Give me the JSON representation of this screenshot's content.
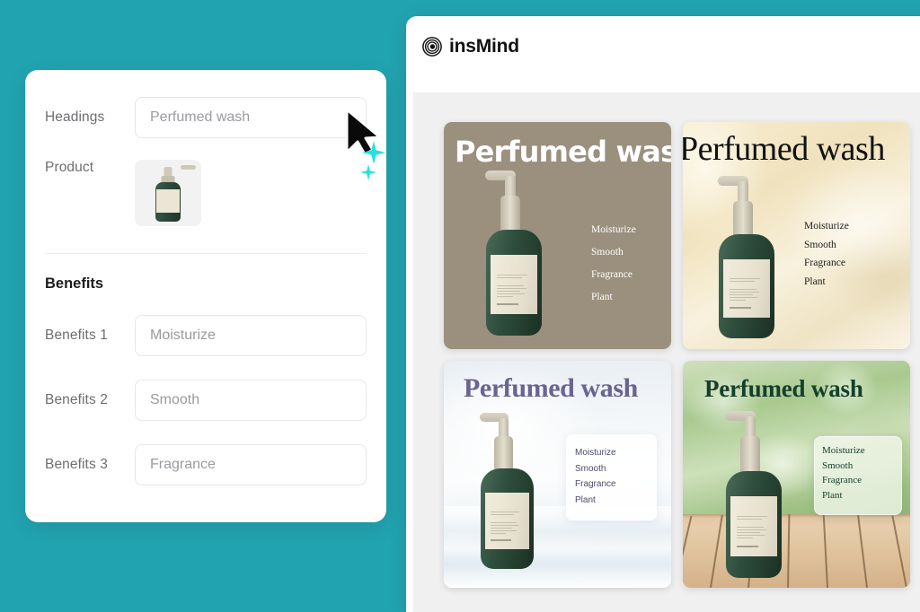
{
  "theme": {
    "background_teal": "#22a3b0",
    "canvas_gray": "#f0f0f1",
    "accent_cyan": "#22e2e2"
  },
  "form_panel": {
    "fields": [
      {
        "label": "Headings",
        "value": "Perfumed wash"
      },
      {
        "label": "Product",
        "value": ""
      }
    ],
    "product_thumbnail_alt": "perfumed-wash-bottle",
    "benefits_heading": "Benefits",
    "benefits": [
      {
        "label": "Benefits 1",
        "value": "Moisturize"
      },
      {
        "label": "Benefits 2",
        "value": "Smooth"
      },
      {
        "label": "Benefits 3",
        "value": "Fragrance"
      }
    ]
  },
  "app": {
    "brand_name": "insMind",
    "logo_icon": "concentric-circles-icon"
  },
  "posters": [
    {
      "title": "Perfumed wash",
      "benefits": [
        "Moisturize",
        "Smooth",
        "Fragrance",
        "Plant"
      ],
      "background_color": "#9b8f7e",
      "title_color": "#ffffff",
      "style_name": "taupe-bold-sans"
    },
    {
      "title": "Perfumed wash",
      "benefits": [
        "Moisturize",
        "Smooth",
        "Fragrance",
        "Plant"
      ],
      "background_color": "#f0e2bd",
      "title_color": "#121212",
      "style_name": "cream-serif"
    },
    {
      "title": "Perfumed wash",
      "benefits": [
        "Moisturize",
        "Smooth",
        "Fragrance",
        "Plant"
      ],
      "background_color": "#eef3f6",
      "title_color": "#6b6391",
      "style_name": "pale-blue-purple-serif"
    },
    {
      "title": "Perfumed wash",
      "benefits": [
        "Moisturize",
        "Smooth",
        "Fragrance",
        "Plant"
      ],
      "background_color": "#a9c98f",
      "title_color": "#14402c",
      "style_name": "park-wood-green-serif"
    }
  ],
  "cursor": {
    "icon": "arrow-pointer-icon"
  },
  "sparkles": {
    "icon": "sparkle-star-icon",
    "count": 2
  }
}
